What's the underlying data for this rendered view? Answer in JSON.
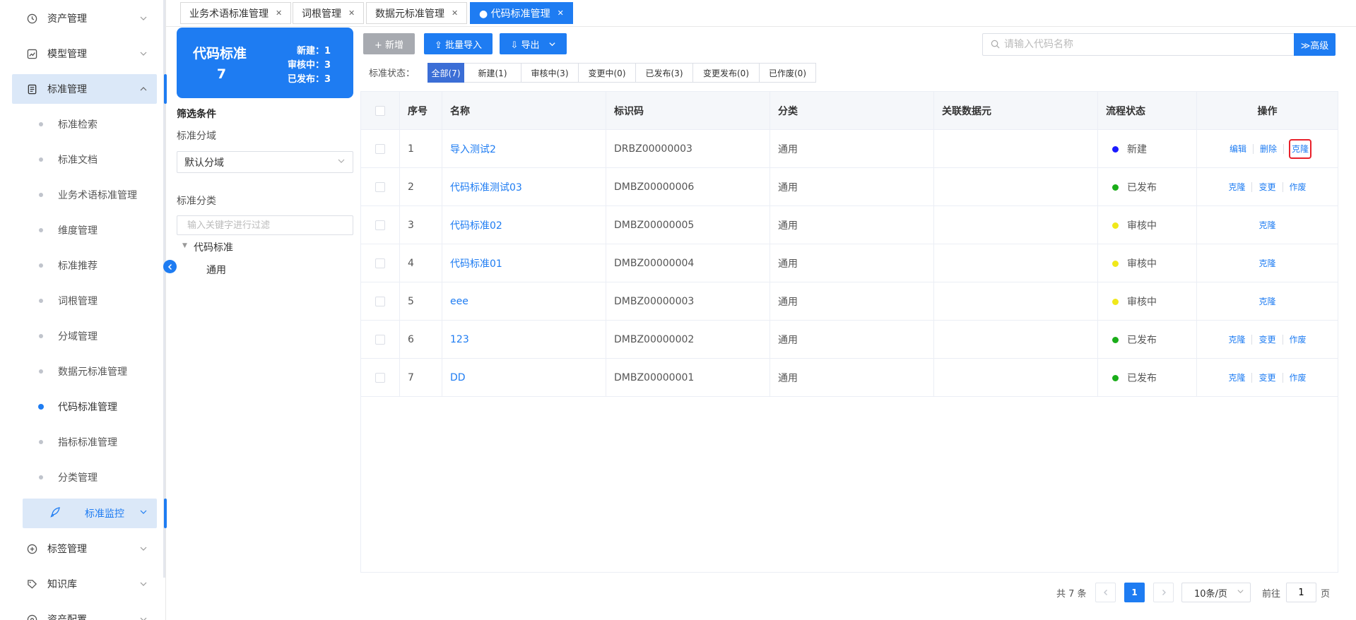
{
  "sidebar": {
    "items": [
      {
        "label": "资产管理",
        "icon": "clock-icon"
      },
      {
        "label": "模型管理",
        "icon": "chart-icon"
      },
      {
        "label": "标准管理",
        "icon": "document-icon"
      },
      {
        "label": "标签管理",
        "icon": "plus-circle-icon"
      },
      {
        "label": "知识库",
        "icon": "tag-icon"
      },
      {
        "label": "资产配置",
        "icon": "settings-icon"
      }
    ],
    "sub_items": [
      "标准检索",
      "标准文档",
      "业务术语标准管理",
      "维度管理",
      "标准推荐",
      "词根管理",
      "分域管理",
      "数据元标准管理",
      "代码标准管理",
      "指标标准管理",
      "分类管理"
    ],
    "monitor_label": "标准监控"
  },
  "tabs": [
    {
      "label": "业务术语标准管理"
    },
    {
      "label": "词根管理"
    },
    {
      "label": "数据元标准管理"
    },
    {
      "label": "● 代码标准管理"
    }
  ],
  "summary": {
    "title": "代码标准",
    "count": "7",
    "stats": [
      "新建：1",
      "审核中：3",
      "已发布：3"
    ]
  },
  "filter": {
    "title": "筛选条件",
    "domain_label": "标准分域",
    "domain_value": "默认分域",
    "category_label": "标准分类",
    "category_placeholder": "输入关键字进行过滤",
    "tree_root": "代码标准",
    "tree_child": "通用"
  },
  "toolbar": {
    "add": "+ 新增",
    "import": "⇪ 批量导入",
    "export": "⇩ 导出",
    "search_placeholder": "请输入代码名称",
    "advanced": "≫高级"
  },
  "status_filter": {
    "label": "标准状态：",
    "options": [
      "全部(7)",
      "新建(1)",
      "审核中(3)",
      "变更中(0)",
      "已发布(3)",
      "变更发布(0)",
      "已作废(0)"
    ]
  },
  "table": {
    "headers": [
      "序号",
      "名称",
      "标识码",
      "分类",
      "关联数据元",
      "流程状态",
      "操作"
    ],
    "rows": [
      {
        "no": "1",
        "name": "导入测试2",
        "code": "DRBZ00000003",
        "category": "通用",
        "related": "",
        "status": "新建",
        "status_color": "#1a1aff",
        "ops": [
          "编辑",
          "删除",
          "克隆"
        ]
      },
      {
        "no": "2",
        "name": "代码标准测试03",
        "code": "DMBZ00000006",
        "category": "通用",
        "related": "",
        "status": "已发布",
        "status_color": "#1aad19",
        "ops": [
          "克隆",
          "变更",
          "作废"
        ]
      },
      {
        "no": "3",
        "name": "代码标准02",
        "code": "DMBZ00000005",
        "category": "通用",
        "related": "",
        "status": "审核中",
        "status_color": "#f0e81a",
        "ops": [
          "克隆"
        ]
      },
      {
        "no": "4",
        "name": "代码标准01",
        "code": "DMBZ00000004",
        "category": "通用",
        "related": "",
        "status": "审核中",
        "status_color": "#f0e81a",
        "ops": [
          "克隆"
        ]
      },
      {
        "no": "5",
        "name": "eee",
        "code": "DMBZ00000003",
        "category": "通用",
        "related": "",
        "status": "审核中",
        "status_color": "#f0e81a",
        "ops": [
          "克隆"
        ]
      },
      {
        "no": "6",
        "name": "123",
        "code": "DMBZ00000002",
        "category": "通用",
        "related": "",
        "status": "已发布",
        "status_color": "#1aad19",
        "ops": [
          "克隆",
          "变更",
          "作废"
        ]
      },
      {
        "no": "7",
        "name": "DD",
        "code": "DMBZ00000001",
        "category": "通用",
        "related": "",
        "status": "已发布",
        "status_color": "#1aad19",
        "ops": [
          "克隆",
          "变更",
          "作废"
        ]
      }
    ]
  },
  "pagination": {
    "total": "共 7 条",
    "current": "1",
    "page_size": "10条/页",
    "goto_label": "前往",
    "goto_value": "1",
    "page_suffix": "页"
  }
}
